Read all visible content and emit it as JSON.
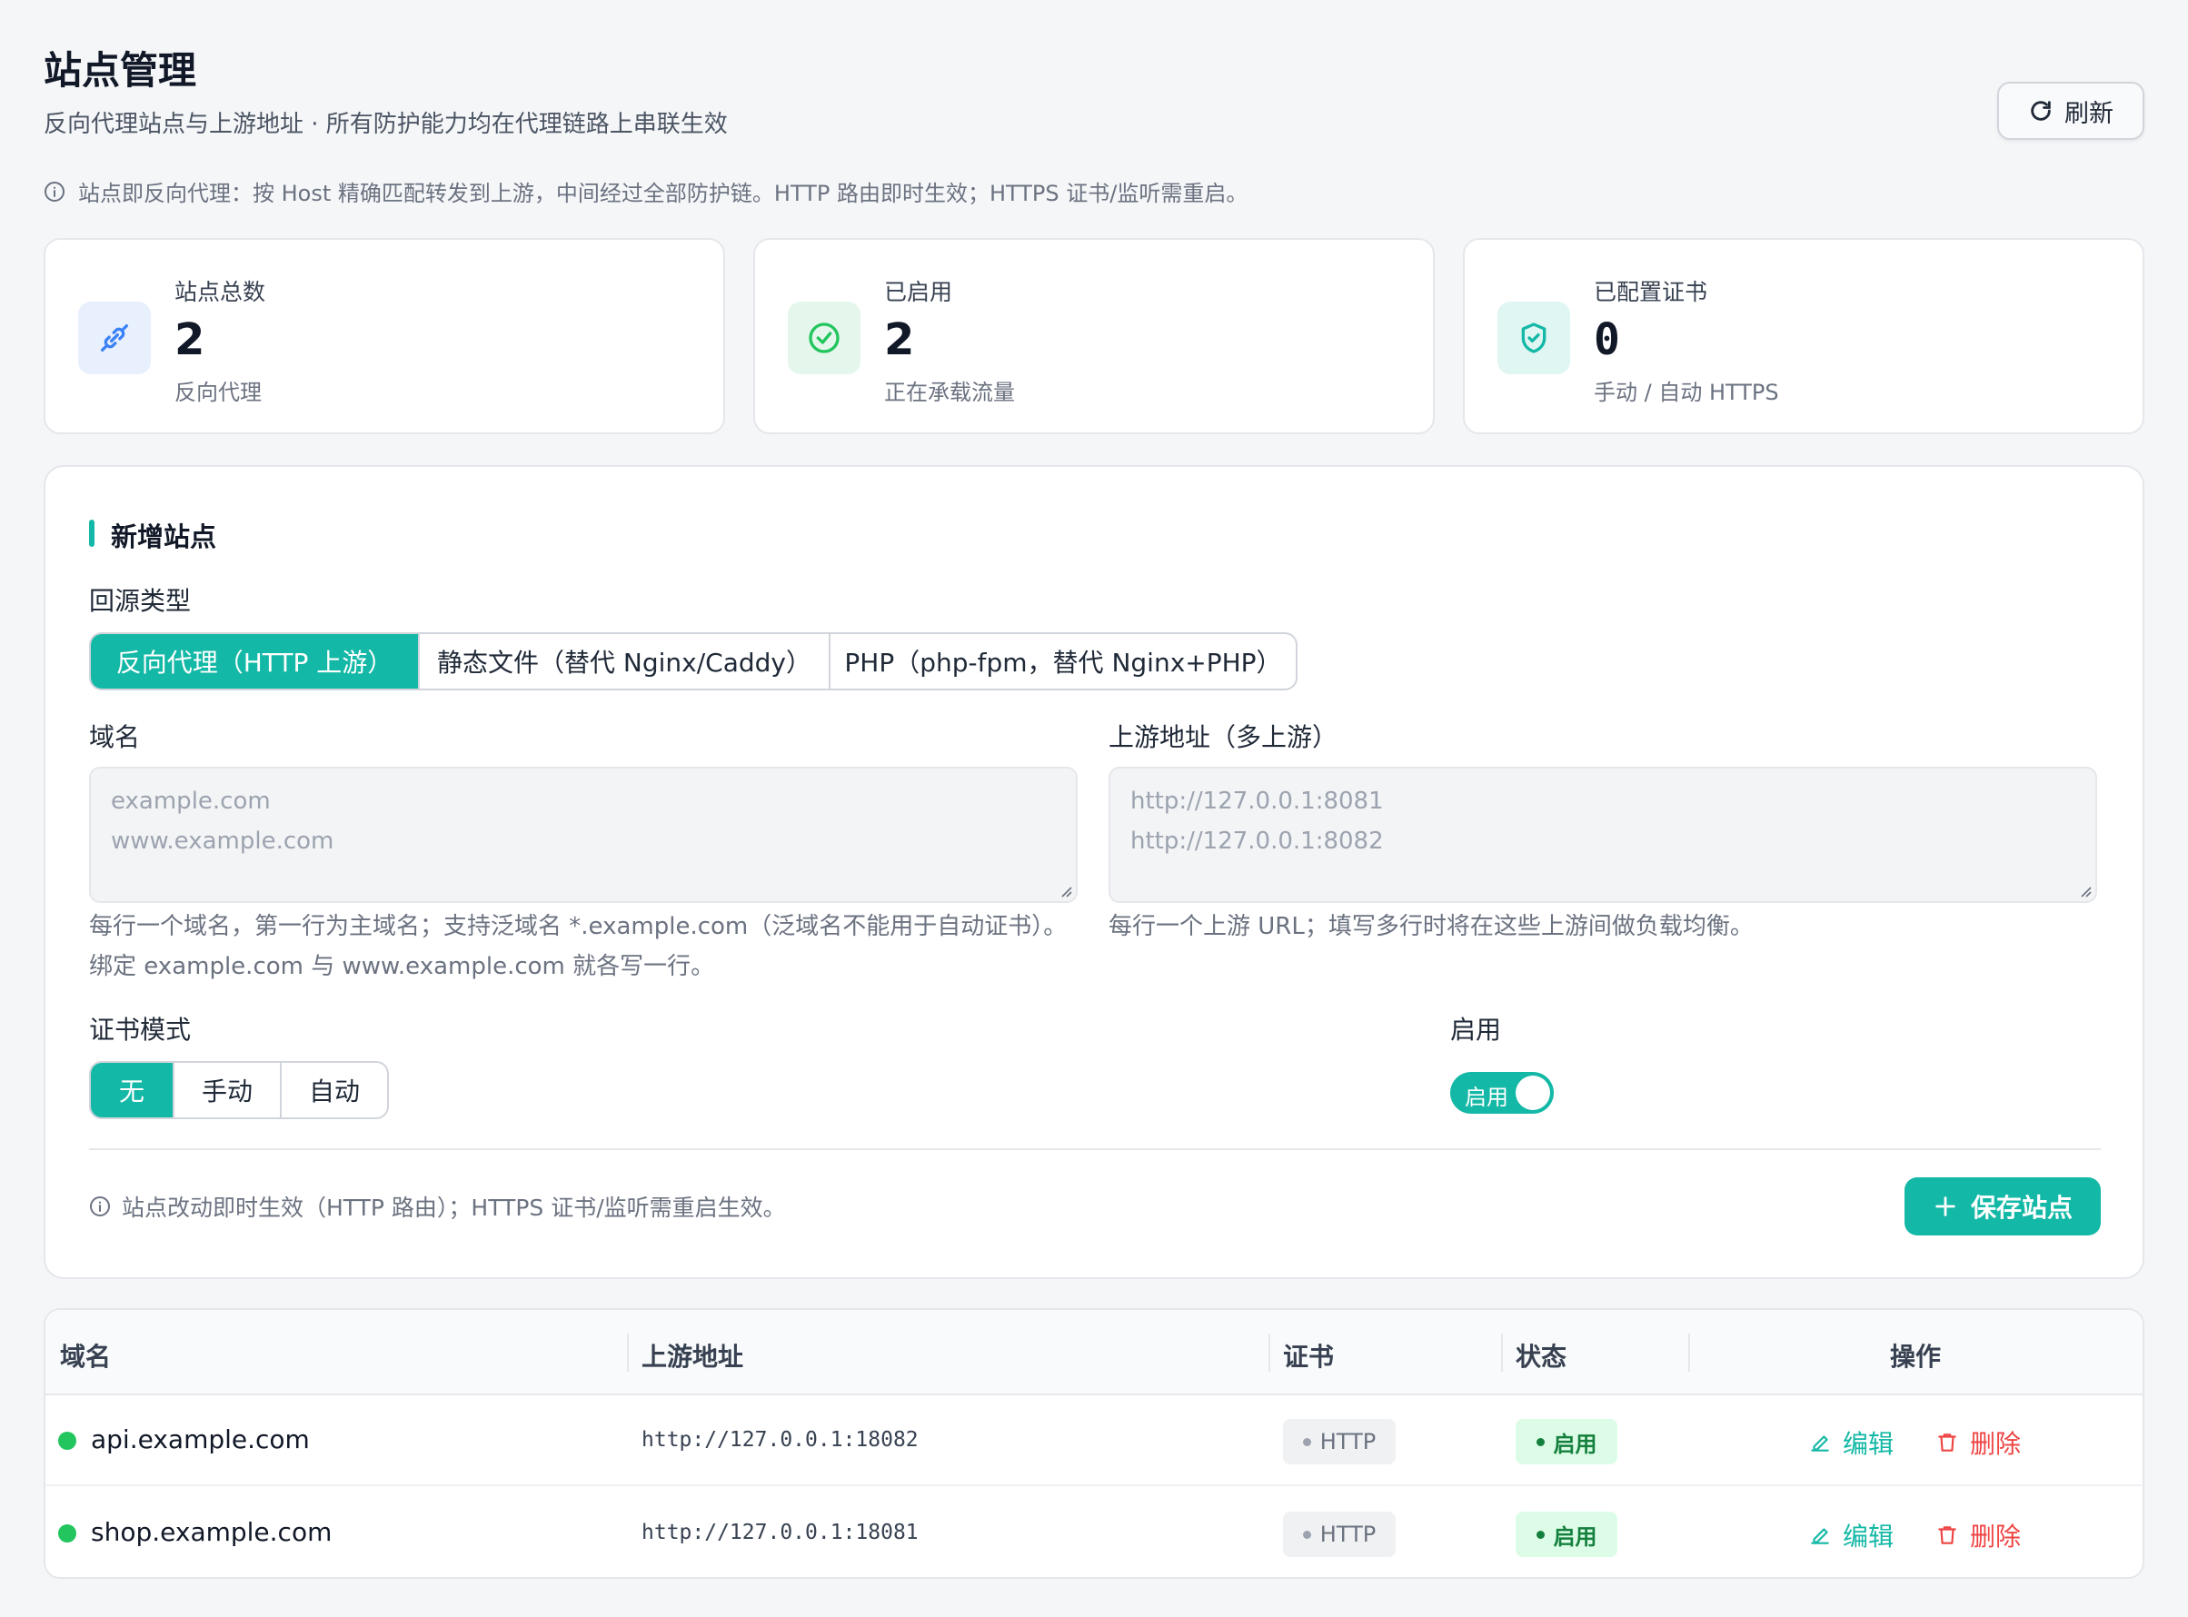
{
  "header": {
    "title": "站点管理",
    "subtitle": "反向代理站点与上游地址 · 所有防护能力均在代理链路上串联生效",
    "refresh_label": "刷新",
    "info": "站点即反向代理：按 Host 精确匹配转发到上游，中间经过全部防护链。HTTP 路由即时生效；HTTPS 证书/监听需重启。"
  },
  "stats": [
    {
      "label": "站点总数",
      "value": "2",
      "sub": "反向代理",
      "icon": "link-icon",
      "color": "#3b82f6"
    },
    {
      "label": "已启用",
      "value": "2",
      "sub": "正在承载流量",
      "icon": "check-circle-icon",
      "color": "#22c55e"
    },
    {
      "label": "已配置证书",
      "value": "0",
      "sub": "手动 / 自动 HTTPS",
      "icon": "shield-check-icon",
      "color": "#14b8a6"
    }
  ],
  "form": {
    "section_title": "新增站点",
    "origin_type_label": "回源类型",
    "origin_types": [
      "反向代理（HTTP 上游）",
      "静态文件（替代 Nginx/Caddy）",
      "PHP（php-fpm，替代 Nginx+PHP）"
    ],
    "origin_type_selected": "反向代理（HTTP 上游）",
    "domain_label": "域名",
    "domain_placeholder_lines": [
      "example.com",
      "www.example.com"
    ],
    "domain_help": "每行一个域名，第一行为主域名；支持泛域名 *.example.com（泛域名不能用于自动证书）。绑定 example.com 与 www.example.com 就各写一行。",
    "upstream_label": "上游地址（多上游）",
    "upstream_placeholder_lines": [
      "http://127.0.0.1:8081",
      "http://127.0.0.1:8082"
    ],
    "upstream_help": "每行一个上游 URL；填写多行时将在这些上游间做负载均衡。",
    "cert_mode_label": "证书模式",
    "cert_modes": [
      "无",
      "手动",
      "自动"
    ],
    "cert_mode_selected": "无",
    "enable_label": "启用",
    "enable_toggle_text": "启用",
    "enabled": true,
    "note": "站点改动即时生效（HTTP 路由）；HTTPS 证书/监听需重启生效。",
    "save_label": "保存站点"
  },
  "table": {
    "columns": [
      "域名",
      "上游地址",
      "证书",
      "状态",
      "操作"
    ],
    "rows": [
      {
        "domain": "api.example.com",
        "upstream": "http://127.0.0.1:18082",
        "cert": "HTTP",
        "status": "启用",
        "edit": "编辑",
        "delete": "删除"
      },
      {
        "domain": "shop.example.com",
        "upstream": "http://127.0.0.1:18081",
        "cert": "HTTP",
        "status": "启用",
        "edit": "编辑",
        "delete": "删除"
      }
    ]
  },
  "colors": {
    "accent": "#14b8a6",
    "danger": "#ef4444",
    "success": "#22c55e"
  }
}
